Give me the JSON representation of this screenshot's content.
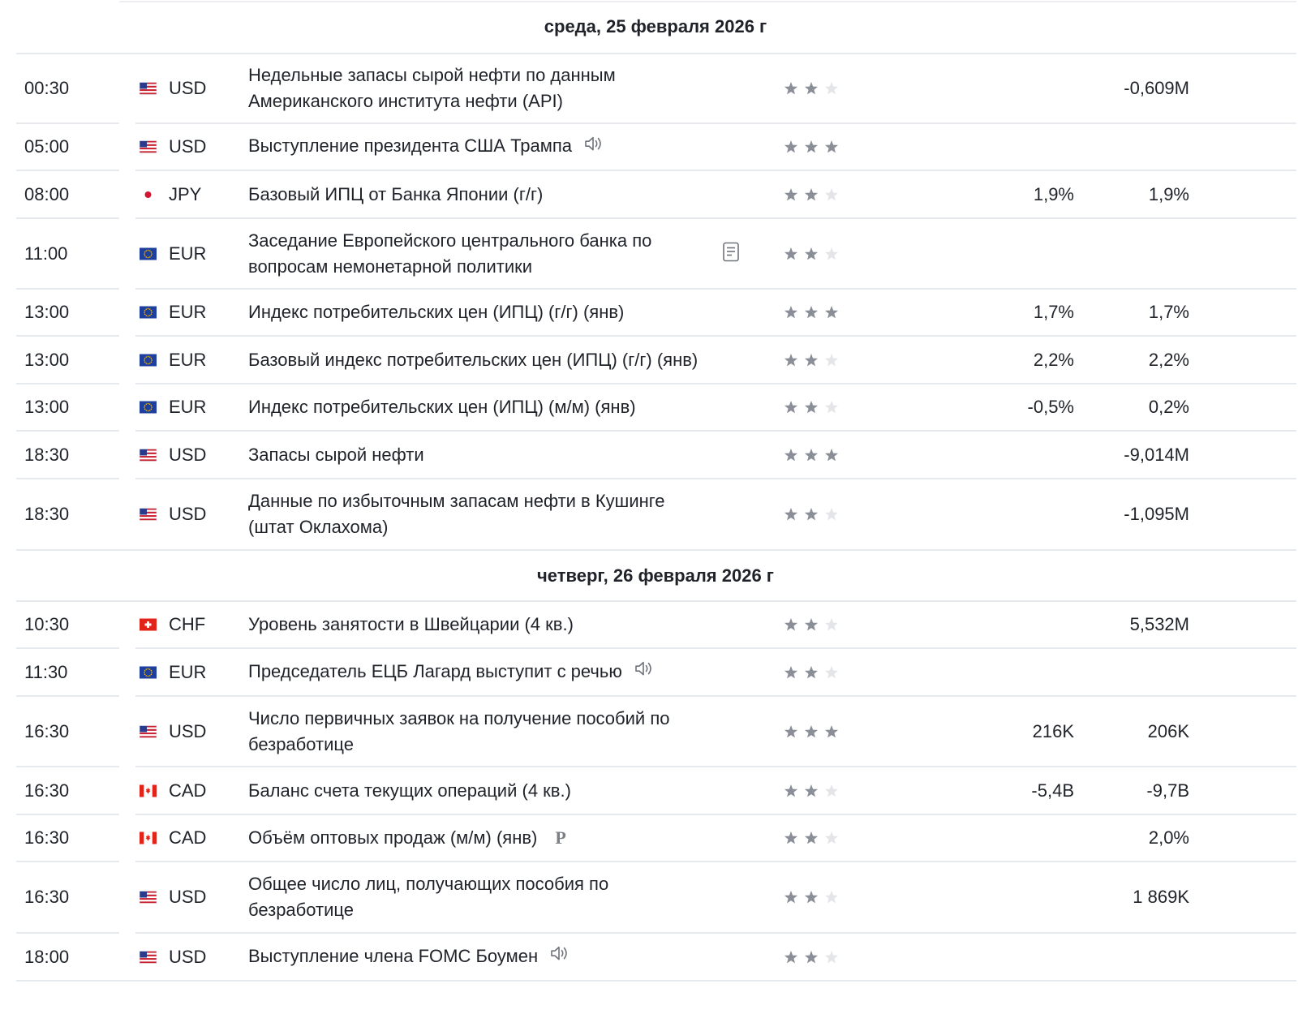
{
  "days": [
    {
      "date": "среда, 25 февраля 2026 г",
      "events": [
        {
          "time": "00:30",
          "flag": "us",
          "currency": "USD",
          "title": "Недельные запасы сырой нефти по данным Американского института нефти (API)",
          "icon": "",
          "stars": 2,
          "actual": "",
          "previous": "-0,609M"
        },
        {
          "time": "05:00",
          "flag": "us",
          "currency": "USD",
          "title": "Выступление президента США Трампа",
          "icon": "speaker-icon",
          "stars": 3,
          "actual": "",
          "previous": ""
        },
        {
          "time": "08:00",
          "flag": "jp",
          "currency": "JPY",
          "title": "Базовый ИПЦ от Банка Японии (г/г)",
          "icon": "",
          "stars": 2,
          "actual": "1,9%",
          "previous": "1,9%"
        },
        {
          "time": "11:00",
          "flag": "eu",
          "currency": "EUR",
          "title": "Заседание Европейского центрального банка по вопросам немонетарной политики",
          "icon": "document-icon",
          "stars": 2,
          "actual": "",
          "previous": ""
        },
        {
          "time": "13:00",
          "flag": "eu",
          "currency": "EUR",
          "title": "Индекс потребительских цен (ИПЦ) (г/г) (янв)",
          "icon": "",
          "stars": 3,
          "actual": "1,7%",
          "previous": "1,7%"
        },
        {
          "time": "13:00",
          "flag": "eu",
          "currency": "EUR",
          "title": "Базовый индекс потребительских цен (ИПЦ) (г/г) (янв)",
          "icon": "",
          "stars": 2,
          "actual": "2,2%",
          "previous": "2,2%"
        },
        {
          "time": "13:00",
          "flag": "eu",
          "currency": "EUR",
          "title": "Индекс потребительских цен (ИПЦ) (м/м) (янв)",
          "icon": "",
          "stars": 2,
          "actual": "-0,5%",
          "previous": "0,2%"
        },
        {
          "time": "18:30",
          "flag": "us",
          "currency": "USD",
          "title": "Запасы сырой нефти",
          "icon": "",
          "stars": 3,
          "actual": "",
          "previous": "-9,014M"
        },
        {
          "time": "18:30",
          "flag": "us",
          "currency": "USD",
          "title": "Данные по избыточным запасам нефти в Кушинге (штат Оклахома)",
          "icon": "",
          "stars": 2,
          "actual": "",
          "previous": "-1,095M"
        }
      ]
    },
    {
      "date": "четверг, 26 февраля 2026 г",
      "events": [
        {
          "time": "10:30",
          "flag": "ch",
          "currency": "CHF",
          "title": "Уровень занятости в Швейцарии (4 кв.)",
          "icon": "",
          "stars": 2,
          "actual": "",
          "previous": "5,532M"
        },
        {
          "time": "11:30",
          "flag": "eu",
          "currency": "EUR",
          "title": "Председатель ЕЦБ Лагард выступит с речью",
          "icon": "speaker-icon",
          "stars": 2,
          "actual": "",
          "previous": ""
        },
        {
          "time": "16:30",
          "flag": "us",
          "currency": "USD",
          "title": "Число первичных заявок на получение пособий по безработице",
          "icon": "",
          "stars": 3,
          "actual": "216K",
          "previous": "206K"
        },
        {
          "time": "16:30",
          "flag": "ca",
          "currency": "CAD",
          "title": "Баланс счета текущих операций (4 кв.)",
          "icon": "",
          "stars": 2,
          "actual": "-5,4B",
          "previous": "-9,7B"
        },
        {
          "time": "16:30",
          "flag": "ca",
          "currency": "CAD",
          "title": "Объём оптовых продаж (м/м) (янв)",
          "icon": "preliminary-icon",
          "icon_text": "P",
          "stars": 2,
          "actual": "",
          "previous": "2,0%"
        },
        {
          "time": "16:30",
          "flag": "us",
          "currency": "USD",
          "title": "Общее число лиц, получающих пособия по безработице",
          "icon": "",
          "stars": 2,
          "actual": "",
          "previous": "1 869K"
        },
        {
          "time": "18:00",
          "flag": "us",
          "currency": "USD",
          "title": "Выступление члена FOMC Боумен",
          "icon": "speaker-icon",
          "stars": 2,
          "actual": "",
          "previous": ""
        }
      ]
    }
  ],
  "colors": {
    "star_filled": "#8a8e96",
    "star_empty": "#e3e5e9",
    "divider": "#e6e9ee",
    "text": "#1f2329"
  }
}
